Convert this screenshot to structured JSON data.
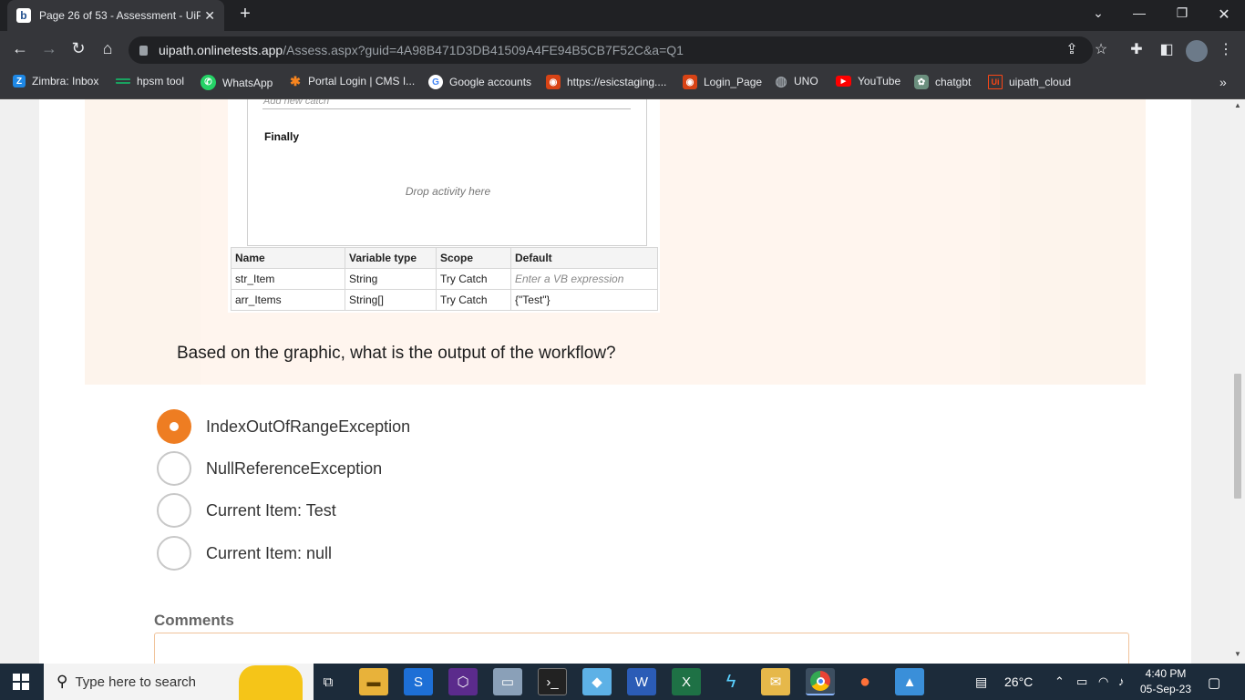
{
  "browser": {
    "tab_title": "Page 26 of 53 - Assessment - UiP",
    "tab_favicon": "b",
    "url_host": "uipath.onlinetests.app",
    "url_path": "/Assess.aspx?guid=4A98B471D3DB41509A4FE94B5CB7F52C&a=Q1"
  },
  "bookmarks": [
    {
      "label": "Zimbra: Inbox",
      "icon": "zimbra-icon",
      "glyph": "Z",
      "color": "#1e88e5"
    },
    {
      "label": "hpsm tool",
      "icon": "hpsm-icon",
      "glyph": "",
      "color": "#1aa260"
    },
    {
      "label": "WhatsApp",
      "icon": "whatsapp-icon",
      "glyph": "✆",
      "color": "#25d366"
    },
    {
      "label": "Portal Login | CMS I...",
      "icon": "portal-icon",
      "glyph": "✱",
      "color": "#f6841f"
    },
    {
      "label": "Google accounts",
      "icon": "google-icon",
      "glyph": "G",
      "color": "#ffffff"
    },
    {
      "label": "https://esicstaging....",
      "icon": "esic-icon",
      "glyph": "◉",
      "color": "#d84315"
    },
    {
      "label": "Login_Page",
      "icon": "login-page-icon",
      "glyph": "◉",
      "color": "#d84315"
    },
    {
      "label": "UNO",
      "icon": "globe-icon",
      "glyph": "◍",
      "color": "#9aa0a6"
    },
    {
      "label": "YouTube",
      "icon": "youtube-icon",
      "glyph": "▶",
      "color": "#ff0000"
    },
    {
      "label": "chatgbt",
      "icon": "chatgpt-icon",
      "glyph": "✿",
      "color": "#6b8f7e"
    },
    {
      "label": "uipath_cloud",
      "icon": "uipath-icon",
      "glyph": "Ui",
      "color": "#fa4616"
    }
  ],
  "workflow": {
    "add_catch": "Add new catch",
    "finally_label": "Finally",
    "drop_hint": "Drop activity here",
    "var_headers": [
      "Name",
      "Variable type",
      "Scope",
      "Default"
    ],
    "vars": [
      {
        "name": "str_Item",
        "type": "String",
        "scope": "Try Catch",
        "default": "Enter a VB expression"
      },
      {
        "name": "arr_Items",
        "type": "String[]",
        "scope": "Try Catch",
        "default": "{\"Test\"}"
      }
    ]
  },
  "question": "Based on the graphic, what is the output of the workflow?",
  "options": [
    {
      "label": "IndexOutOfRangeException",
      "selected": true
    },
    {
      "label": "NullReferenceException",
      "selected": false
    },
    {
      "label": "Current Item: Test",
      "selected": false
    },
    {
      "label": "Current Item: null",
      "selected": false
    }
  ],
  "comments_label": "Comments",
  "taskbar": {
    "search_placeholder": "Type here to search",
    "temperature": "26°C",
    "time": "4:40 PM",
    "date": "05-Sep-23"
  }
}
